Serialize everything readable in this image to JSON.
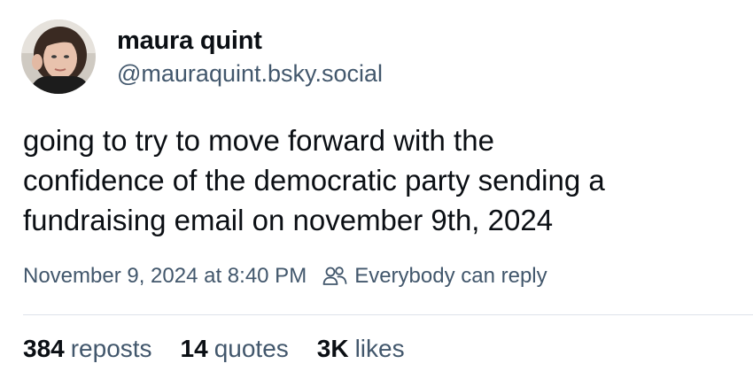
{
  "author": {
    "display_name": "maura quint",
    "handle": "@mauraquint.bsky.social"
  },
  "post": {
    "text": "going to try to move forward with the\nconfidence of the democratic party sending a\nfundraising email on november 9th, 2024",
    "timestamp": "November 9, 2024 at 8:40 PM",
    "reply_setting": "Everybody can reply",
    "reply_icon": "people-icon"
  },
  "stats": {
    "reposts": {
      "count": "384",
      "label": "reposts"
    },
    "quotes": {
      "count": "14",
      "label": "quotes"
    },
    "likes": {
      "count": "3K",
      "label": "likes"
    }
  },
  "colors": {
    "text": "#0b0f14",
    "muted": "#42576c",
    "divider": "#dde3ea",
    "background": "#ffffff"
  }
}
